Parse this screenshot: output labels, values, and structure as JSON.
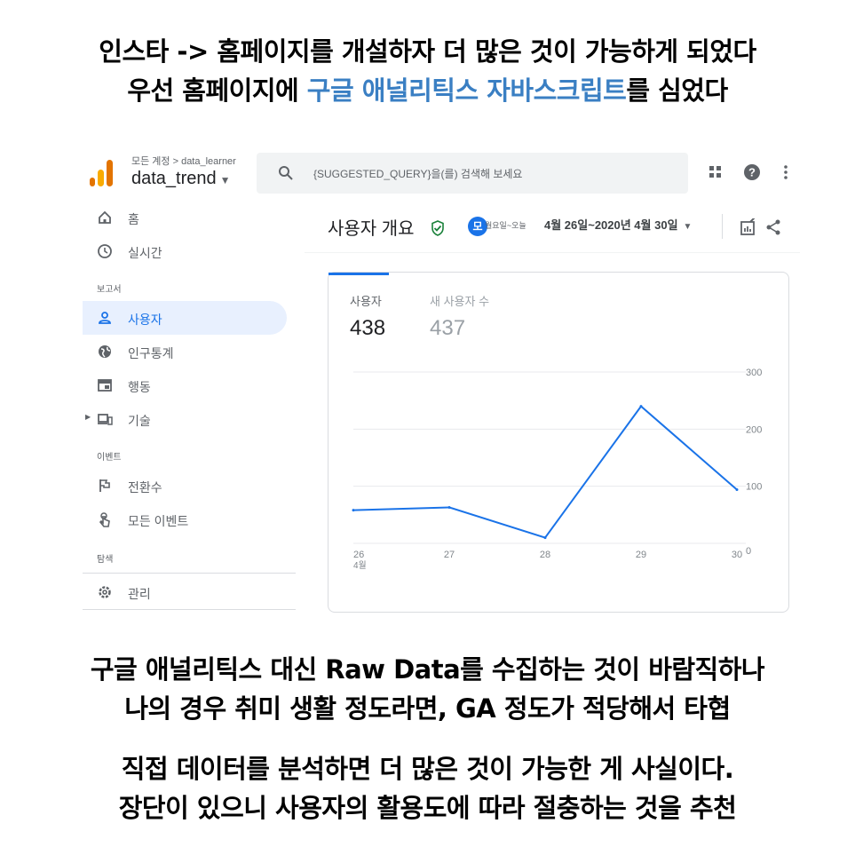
{
  "captions": {
    "top_line1": "인스타 -> 홈페이지를 개설하자 더 많은 것이 가능하게 되었다",
    "top_line2_pre": "우선 홈페이지에 ",
    "top_line2_accent": "구글 애널리틱스 자바스크립트",
    "top_line2_post": "를 심었다",
    "mid_line1": "구글 애널리틱스 대신 Raw Data를 수집하는 것이 바람직하나",
    "mid_line2": "나의 경우 취미 생활 정도라면, GA 정도가 적당해서 타협",
    "bot_line1": "직접 데이터를 분석하면 더 많은 것이 가능한 게 사실이다.",
    "bot_line2": "장단이 있으니 사용자의 활용도에 따라 절충하는 것을 추천"
  },
  "colors": {
    "accent_caption": "#3a7fc3",
    "ga_blue": "#1a73e8",
    "check_green": "#188038"
  },
  "header": {
    "account_path": "모든 계정 > data_learner",
    "property": "data_trend",
    "search_placeholder": "{SUGGESTED_QUERY}을(를) 검색해 보세요",
    "icons": [
      "apps-icon",
      "help-icon",
      "more-vert-icon"
    ]
  },
  "sidebar": {
    "items": [
      {
        "label": "홈",
        "icon": "home-icon"
      },
      {
        "label": "실시간",
        "icon": "clock-icon"
      },
      {
        "label": "사용자",
        "icon": "person-icon",
        "active": true
      },
      {
        "label": "인구통계",
        "icon": "globe-icon"
      },
      {
        "label": "행동",
        "icon": "behavior-icon"
      },
      {
        "label": "기술",
        "icon": "devices-icon"
      },
      {
        "label": "전환수",
        "icon": "flag-icon"
      },
      {
        "label": "모든 이벤트",
        "icon": "touch-icon"
      },
      {
        "label": "관리",
        "icon": "gear-icon"
      }
    ],
    "sections": {
      "reports": "보고서",
      "events": "이벤트",
      "explore": "탐색"
    }
  },
  "main": {
    "title": "사용자 개요",
    "date_badge": "모",
    "date_compare": "월요일~오늘",
    "date_range": "4월 26일~2020년 4월 30일"
  },
  "metrics": [
    {
      "label": "사용자",
      "value": "438"
    },
    {
      "label": "새 사용자 수",
      "value": "437"
    }
  ],
  "chart_data": {
    "type": "line",
    "x": [
      "26",
      "27",
      "28",
      "29",
      "30"
    ],
    "x_sublabel_first": "4월",
    "series": [
      {
        "values": [
          58,
          63,
          10,
          240,
          94
        ]
      }
    ],
    "y_ticks": [
      "0",
      "100",
      "200",
      "300"
    ],
    "ylim": [
      0,
      300
    ],
    "grid": true
  }
}
